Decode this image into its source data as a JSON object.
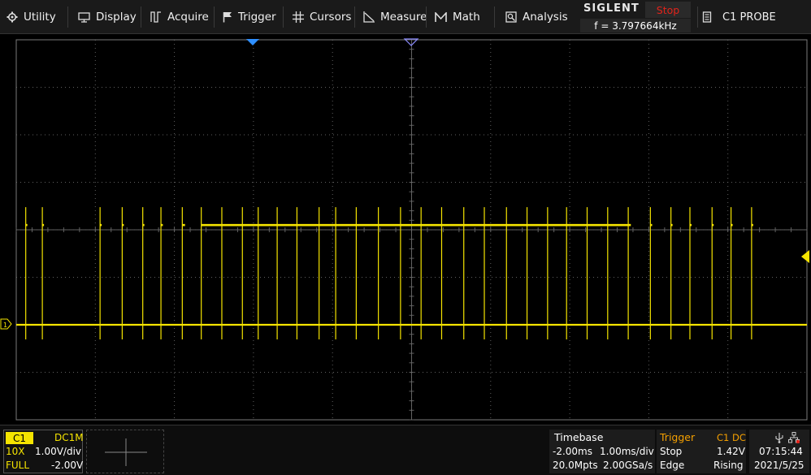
{
  "menu": {
    "items": [
      {
        "label": "Utility",
        "icon": "gear-icon"
      },
      {
        "label": "Display",
        "icon": "monitor-icon"
      },
      {
        "label": "Acquire",
        "icon": "acquire-icon"
      },
      {
        "label": "Trigger",
        "icon": "flag-icon"
      },
      {
        "label": "Cursors",
        "icon": "cursor-grid-icon"
      },
      {
        "label": "Measure",
        "icon": "measure-icon"
      },
      {
        "label": "Math",
        "icon": "math-icon"
      },
      {
        "label": "Analysis",
        "icon": "analysis-icon"
      }
    ]
  },
  "brand": {
    "name": "SIGLENT",
    "run_state": "Stop",
    "frequency": "f = 3.797664kHz"
  },
  "probe": {
    "label": "C1 PROBE",
    "icon": "probe-icon"
  },
  "colors": {
    "trace": "#f5e400",
    "stop": "#e2231a",
    "trigger_marker": "#2e8fff",
    "grid": "#6b6b6b",
    "trigger_panel": "#f5a000"
  },
  "waveform": {
    "channel": "C1",
    "ground_marker_label": "1",
    "pulse_positions_div": [
      0.12,
      0.33,
      1.06,
      1.34,
      1.6,
      1.83,
      2.1,
      2.34,
      2.6,
      2.86,
      3.06,
      3.3,
      3.55,
      3.83,
      4.04,
      4.3,
      4.58,
      4.86,
      5.12,
      5.38,
      5.66,
      5.92,
      6.2,
      6.46,
      6.72,
      6.96,
      7.22,
      7.48,
      7.74,
      8.02,
      8.28,
      8.52,
      8.8,
      9.04,
      9.3
    ],
    "high_level_v": 2.1,
    "low_level_v": 0.0
  },
  "channel_info": {
    "tag": "C1",
    "coupling": "DC1M",
    "probe_ratio": "10X",
    "scale": "1.00V/div",
    "bandwidth": "FULL",
    "offset": "-2.00V"
  },
  "timebase": {
    "title": "Timebase",
    "delay": "-2.00ms",
    "scale": "1.00ms/div",
    "memory": "20.0Mpts",
    "sample_rate": "2.00GSa/s"
  },
  "trigger": {
    "title": "Trigger",
    "source": "C1 DC",
    "mode": "Stop",
    "level": "1.42V",
    "type": "Edge",
    "slope": "Rising"
  },
  "clock": {
    "time": "07:15:44",
    "date": "2021/5/25",
    "usb_icon": "usb-icon",
    "network_icon": "network-icon"
  }
}
